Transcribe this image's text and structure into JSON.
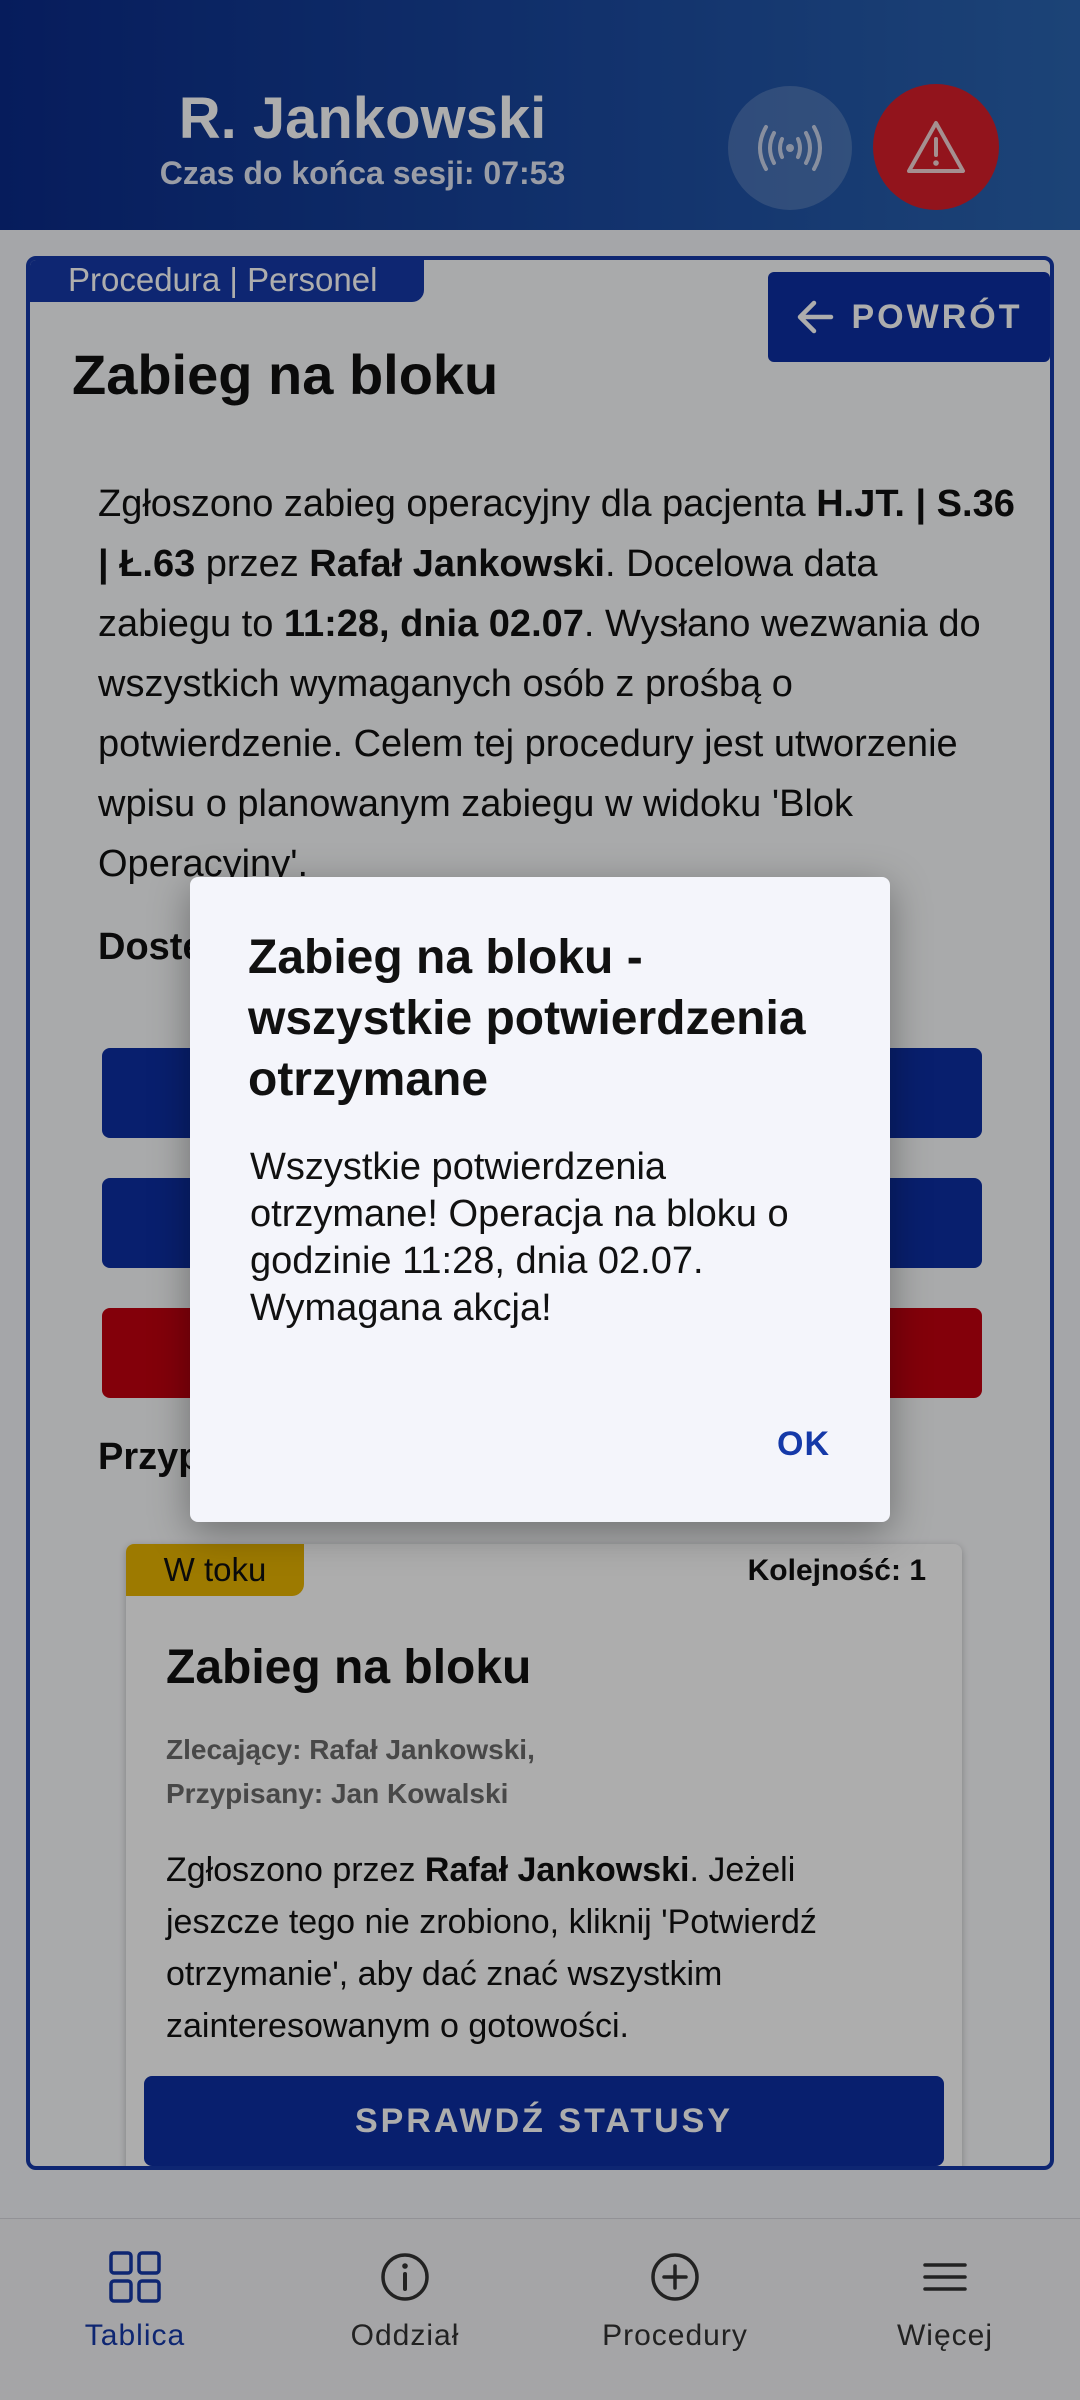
{
  "header": {
    "user_name": "R. Jankowski",
    "session_text": "Czas do końca sesji: 07:53",
    "nfc_icon": "nfc-signal-icon",
    "alert_icon": "warning-icon"
  },
  "panel": {
    "tag": "Procedura | Personel",
    "back_label": "POWRÓT",
    "title": "Zabieg na bloku",
    "description": {
      "p1": "Zgłoszono zabieg operacyjny dla pacjenta ",
      "patient": "H.JT. | S.36 | Ł.63",
      "p2": " przez ",
      "author": "Rafał Jankowski",
      "p3": ". Docelowa data zabiegu to ",
      "date": "11:28, dnia 02.07",
      "p4": ". Wysłano wezwania do wszystkich wymaganych osób z prośbą o potwierdzenie. Celem tej procedury jest utworzenie wpisu o planowanym zabiegu w widoku 'Blok Operacyjny'."
    },
    "available_label": "Dostę",
    "assigned_label": "Przyp"
  },
  "task": {
    "status": "W toku",
    "order": "Kolejność: 1",
    "title": "Zabieg na bloku",
    "ordering": "Zlecający: Rafał Jankowski,",
    "assigned": "Przypisany: Jan Kowalski",
    "desc_p1": "Zgłoszono przez ",
    "desc_author": "Rafał Jankowski",
    "desc_p2": ". Jeżeli jeszcze tego nie zrobiono, kliknij 'Potwierdź otrzymanie', aby dać znać wszystkim zainteresowanym o gotowości.",
    "button": "SPRAWDŹ STATUSY"
  },
  "nav": {
    "items": [
      {
        "label": "Tablica",
        "icon": "grid-icon",
        "active": true
      },
      {
        "label": "Oddział",
        "icon": "info-icon",
        "active": false
      },
      {
        "label": "Procedury",
        "icon": "plus-circle-icon",
        "active": false
      },
      {
        "label": "Więcej",
        "icon": "menu-icon",
        "active": false
      }
    ]
  },
  "dialog": {
    "title": "Zabieg na bloku - wszystkie potwierdzenia otrzymane",
    "body": "Wszystkie potwierdzenia otrzymane! Operacja na bloku o godzinie 11:28, dnia 02.07. Wymagana akcja!",
    "ok_label": "OK"
  },
  "colors": {
    "primary": "#0d2fa2",
    "danger": "#d81e2a",
    "status_in_progress": "#e8b400"
  }
}
